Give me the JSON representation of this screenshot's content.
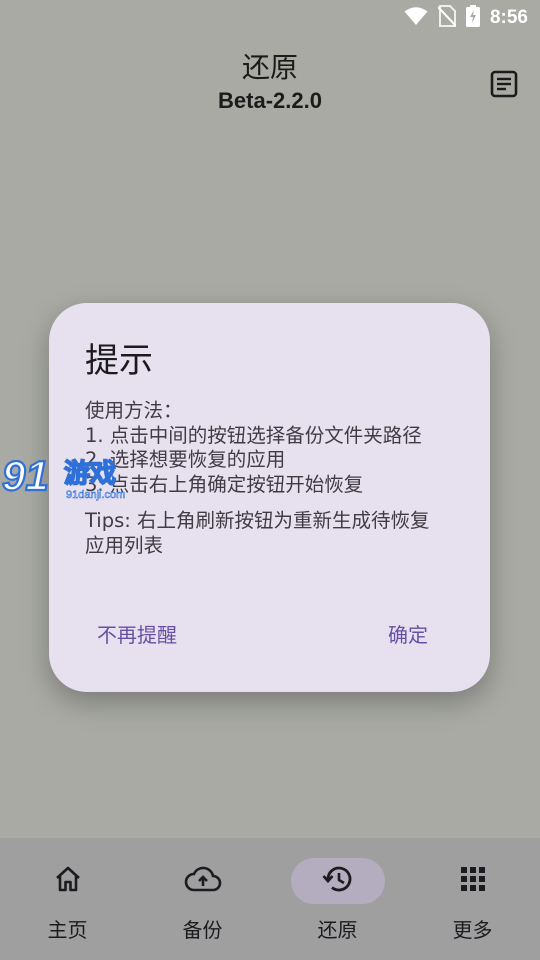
{
  "status_bar": {
    "time": "8:56",
    "icons": [
      "wifi-icon",
      "no-sim-icon",
      "battery-charging-icon"
    ]
  },
  "header": {
    "title": "还原",
    "subtitle": "Beta-2.2.0",
    "action_icon": "log-icon"
  },
  "dialog": {
    "title": "提示",
    "body_lines": [
      "使用方法：",
      "1. 点击中间的按钮选择备份文件夹路径",
      "2. 选择想要恢复的应用",
      "3. 点击右上角确定按钮开始恢复"
    ],
    "tips_lines": [
      "Tips: 右上角刷新按钮为重新生成待恢复",
      "应用列表"
    ],
    "dismiss_label": "不再提醒",
    "confirm_label": "确定"
  },
  "watermark": {
    "logo": "91游戏",
    "site": "91danji.com"
  },
  "bottom_nav": {
    "items": [
      {
        "label": "主页",
        "icon": "home-icon"
      },
      {
        "label": "备份",
        "icon": "cloud-upload-icon"
      },
      {
        "label": "还原",
        "icon": "restore-history-icon",
        "active": true
      },
      {
        "label": "更多",
        "icon": "apps-grid-icon"
      }
    ]
  },
  "colors": {
    "background": "#a9aaa4",
    "dialog": "#e7e1ef",
    "accent": "#6750a4",
    "nav_active_pill": "#b4adbf"
  }
}
